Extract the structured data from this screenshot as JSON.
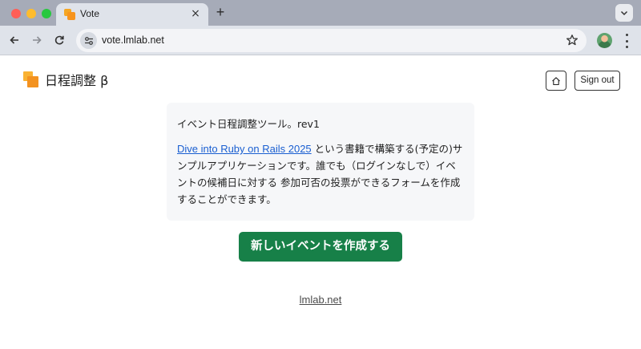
{
  "browser": {
    "tab_title": "Vote",
    "tab_close": "×",
    "new_tab": "+",
    "url": "vote.lmlab.net"
  },
  "header": {
    "brand": "日程調整 β",
    "signout_label": "Sign out"
  },
  "card": {
    "line1": "イベント日程調整ツール。rev1",
    "link_text": "Dive into Ruby on Rails 2025",
    "text_after_link": " という書籍で構築する(予定の)サンプルアプリケーションです。誰でも（ログインなしで）イベントの候補日に対する 参加可否の投票ができるフォームを作成することができます。"
  },
  "main": {
    "create_button": "新しいイベントを作成する"
  },
  "footer": {
    "link": "lmlab.net"
  },
  "colors": {
    "primary_button": "#178048",
    "link": "#1a5fd1",
    "brand_orange": "#f39220"
  }
}
